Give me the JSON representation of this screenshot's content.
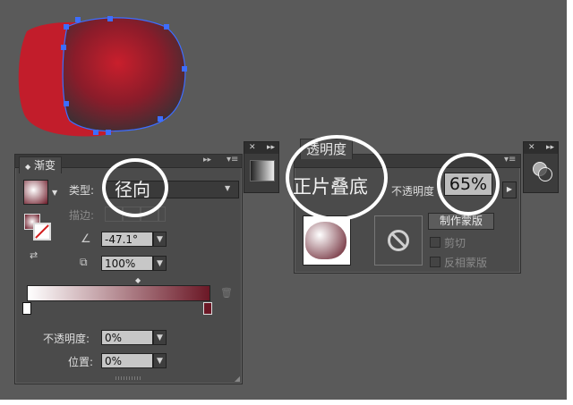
{
  "gradient_panel": {
    "tab_label": "渐变",
    "type_label": "类型:",
    "type_value": "径向",
    "stroke_label": "描边:",
    "angle_value": "-47.1°",
    "aspect_value": "100%",
    "opacity_label": "不透明度:",
    "opacity_value": "0%",
    "location_label": "位置:",
    "location_value": "0%",
    "gradient_colors": {
      "start": "#ffffff",
      "end": "#6b1826"
    }
  },
  "transparency_panel": {
    "tab_label": "透明度",
    "blend_mode_value": "正片叠底",
    "opacity_label": "不透明度",
    "opacity_value": "65%",
    "make_mask_label": "制作蒙版",
    "clip_label": "剪切",
    "invert_mask_label": "反相蒙版"
  },
  "colors": {
    "canvas_bg": "#5a5a5a",
    "red_shape": "#c21d2b",
    "selection": "#3d6dff"
  }
}
